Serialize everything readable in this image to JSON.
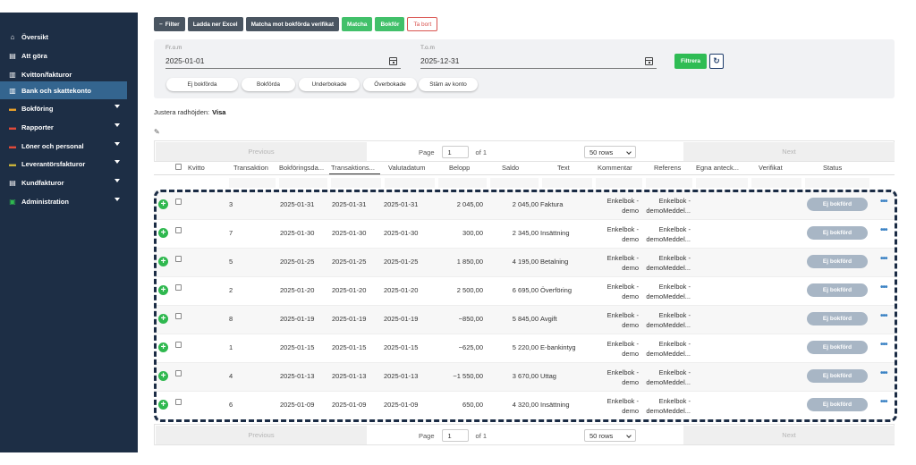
{
  "sidebar": {
    "items": [
      {
        "label": "Översikt",
        "icon": "home-icon"
      },
      {
        "label": "Att göra",
        "icon": "list-icon"
      },
      {
        "label": "Kvitton/fakturor",
        "icon": "receipt-icon"
      },
      {
        "label": "Bank och skattekonto",
        "icon": "bank-icon",
        "active": true
      },
      {
        "label": "Bokföring",
        "icon": "ledger-icon",
        "caret": true
      },
      {
        "label": "Rapporter",
        "icon": "report-icon",
        "caret": true
      },
      {
        "label": "Löner och personal",
        "icon": "payroll-icon",
        "caret": true
      },
      {
        "label": "Leverantörsfakturor",
        "icon": "supplier-icon",
        "caret": true
      },
      {
        "label": "Kundfakturor",
        "icon": "customer-icon",
        "caret": true
      },
      {
        "label": "Administration",
        "icon": "admin-icon",
        "caret": true
      }
    ]
  },
  "toolbar": {
    "filter": "Filter",
    "download": "Ladda ner Excel",
    "match_booked": "Matcha mot bokförda verifikat",
    "match": "Matcha",
    "book": "Bokför",
    "remove": "Ta bort"
  },
  "filters": {
    "from_label": "Fr.o.m",
    "from_value": "2025-01-01",
    "to_label": "T.o.m",
    "to_value": "2025-12-31",
    "filter_button": "Filtrera",
    "quick": [
      "Ej bokförda",
      "Bokförda",
      "Underbokade",
      "Överbokade",
      "Stäm av konto"
    ]
  },
  "row_height": {
    "label": "Justera radhöjden:",
    "value": "Visa"
  },
  "pager": {
    "previous": "Previous",
    "page_label": "Page",
    "page": "1",
    "of": "of 1",
    "rows": "50 rows",
    "next": "Next"
  },
  "columns": [
    "Kvitto",
    "Transaktion",
    "Bokföringsda...",
    "Transaktions...",
    "Valutadatum",
    "Belopp",
    "Saldo",
    "Text",
    "Kommentar",
    "Referens",
    "Egna anteck...",
    "Verifikat",
    "Status"
  ],
  "rows": [
    {
      "transaktion": "3",
      "bokforing": "2025-01-31",
      "transdatum": "2025-01-31",
      "valuta": "2025-01-31",
      "belopp": "2 045,00",
      "saldo": "2 045,00",
      "text": "Faktura",
      "kom1": "Enkelbok -",
      "kom2": "demo",
      "ref1": "Enkelbok -",
      "ref2": "demoMeddel...",
      "status": "Ej bokförd"
    },
    {
      "transaktion": "7",
      "bokforing": "2025-01-30",
      "transdatum": "2025-01-30",
      "valuta": "2025-01-30",
      "belopp": "300,00",
      "saldo": "2 345,00",
      "text": "Insättning",
      "kom1": "Enkelbok -",
      "kom2": "demo",
      "ref1": "Enkelbok -",
      "ref2": "demoMeddel...",
      "status": "Ej bokförd"
    },
    {
      "transaktion": "5",
      "bokforing": "2025-01-25",
      "transdatum": "2025-01-25",
      "valuta": "2025-01-25",
      "belopp": "1 850,00",
      "saldo": "4 195,00",
      "text": "Betalning",
      "kom1": "Enkelbok -",
      "kom2": "demo",
      "ref1": "Enkelbok -",
      "ref2": "demoMeddel...",
      "status": "Ej bokförd"
    },
    {
      "transaktion": "2",
      "bokforing": "2025-01-20",
      "transdatum": "2025-01-20",
      "valuta": "2025-01-20",
      "belopp": "2 500,00",
      "saldo": "6 695,00",
      "text": "Överföring",
      "kom1": "Enkelbok -",
      "kom2": "demo",
      "ref1": "Enkelbok -",
      "ref2": "demoMeddel...",
      "status": "Ej bokförd"
    },
    {
      "transaktion": "8",
      "bokforing": "2025-01-19",
      "transdatum": "2025-01-19",
      "valuta": "2025-01-19",
      "belopp": "−850,00",
      "saldo": "5 845,00",
      "text": "Avgift",
      "kom1": "Enkelbok -",
      "kom2": "demo",
      "ref1": "Enkelbok -",
      "ref2": "demoMeddel...",
      "status": "Ej bokförd"
    },
    {
      "transaktion": "1",
      "bokforing": "2025-01-15",
      "transdatum": "2025-01-15",
      "valuta": "2025-01-15",
      "belopp": "−625,00",
      "saldo": "5 220,00",
      "text": "E-bankintyg",
      "kom1": "Enkelbok -",
      "kom2": "demo",
      "ref1": "Enkelbok -",
      "ref2": "demoMeddel...",
      "status": "Ej bokförd"
    },
    {
      "transaktion": "4",
      "bokforing": "2025-01-13",
      "transdatum": "2025-01-13",
      "valuta": "2025-01-13",
      "belopp": "−1 550,00",
      "saldo": "3 670,00",
      "text": "Uttag",
      "kom1": "Enkelbok -",
      "kom2": "demo",
      "ref1": "Enkelbok -",
      "ref2": "demoMeddel...",
      "status": "Ej bokförd"
    },
    {
      "transaktion": "6",
      "bokforing": "2025-01-09",
      "transdatum": "2025-01-09",
      "valuta": "2025-01-09",
      "belopp": "650,00",
      "saldo": "4 320,00",
      "text": "Insättning",
      "kom1": "Enkelbok -",
      "kom2": "demo",
      "ref1": "Enkelbok -",
      "ref2": "demoMeddel...",
      "status": "Ej bokförd"
    }
  ]
}
